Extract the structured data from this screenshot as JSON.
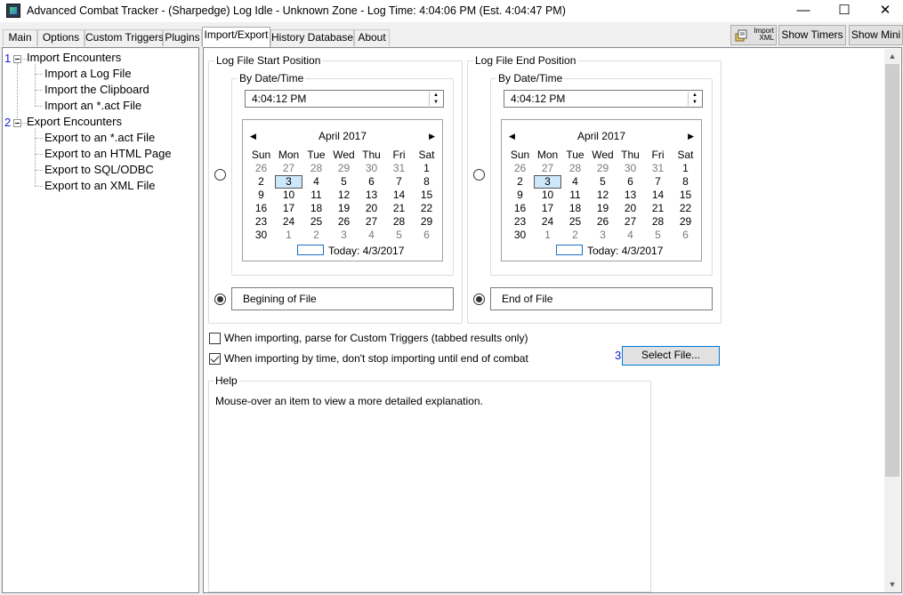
{
  "window": {
    "title": "Advanced Combat Tracker - (Sharpedge) Log Idle - Unknown Zone - Log Time: 4:04:06 PM (Est. 4:04:47 PM)",
    "minimize": "—",
    "maximize": "☐",
    "close": "✕"
  },
  "tabs": [
    {
      "label": "Main"
    },
    {
      "label": "Options"
    },
    {
      "label": "Custom Triggers"
    },
    {
      "label": "Plugins"
    },
    {
      "label": "Import/Export",
      "active": true
    },
    {
      "label": "History Database"
    },
    {
      "label": "About"
    }
  ],
  "toolbar": {
    "import_xml_label_1": "Import",
    "import_xml_label_2": "XML",
    "show_timers": "Show Timers",
    "show_mini": "Show Mini"
  },
  "tree": {
    "groups": [
      {
        "number": "1",
        "label": "Import Encounters",
        "items": [
          "Import a Log File",
          "Import the Clipboard",
          "Import an *.act File"
        ]
      },
      {
        "number": "2",
        "label": "Export Encounters",
        "items": [
          "Export to an *.act File",
          "Export to an HTML Page",
          "Export to SQL/ODBC",
          "Export to an XML File"
        ]
      }
    ]
  },
  "start": {
    "group_title": "Log File Start Position",
    "bydate_title": "By Date/Time",
    "time_value": "4:04:12 PM",
    "calendar_title": "April 2017",
    "position_label": "Begining of File",
    "radio_bydate_checked": false,
    "radio_file_checked": true
  },
  "end": {
    "group_title": "Log File End Position",
    "bydate_title": "By Date/Time",
    "time_value": "4:04:12 PM",
    "calendar_title": "April 2017",
    "position_label": "End of File",
    "radio_bydate_checked": false,
    "radio_file_checked": true
  },
  "calendar": {
    "weekdays": [
      "Sun",
      "Mon",
      "Tue",
      "Wed",
      "Thu",
      "Fri",
      "Sat"
    ],
    "weeks": [
      [
        "26",
        "27",
        "28",
        "29",
        "30",
        "31",
        "1"
      ],
      [
        "2",
        "3",
        "4",
        "5",
        "6",
        "7",
        "8"
      ],
      [
        "9",
        "10",
        "11",
        "12",
        "13",
        "14",
        "15"
      ],
      [
        "16",
        "17",
        "18",
        "19",
        "20",
        "21",
        "22"
      ],
      [
        "23",
        "24",
        "25",
        "26",
        "27",
        "28",
        "29"
      ],
      [
        "30",
        "1",
        "2",
        "3",
        "4",
        "5",
        "6"
      ]
    ],
    "other_month": [
      [
        0,
        0
      ],
      [
        0,
        1
      ],
      [
        0,
        2
      ],
      [
        0,
        3
      ],
      [
        0,
        4
      ],
      [
        0,
        5
      ],
      [
        5,
        1
      ],
      [
        5,
        2
      ],
      [
        5,
        3
      ],
      [
        5,
        4
      ],
      [
        5,
        5
      ],
      [
        5,
        6
      ]
    ],
    "selected": [
      1,
      1
    ],
    "today_label": "Today: 4/3/2017"
  },
  "options": {
    "parse_triggers_label": "When importing, parse for Custom Triggers (tabbed results only)",
    "parse_triggers_checked": false,
    "until_end_label": "When importing by time, don't stop importing until end of combat",
    "until_end_checked": true
  },
  "select_file": {
    "number": "3",
    "label": "Select File..."
  },
  "help": {
    "title": "Help",
    "text": "Mouse-over an item to view a more detailed explanation."
  },
  "colors": {
    "selection_fill": "#cde8fb",
    "focus_border": "#0078d7",
    "marker_number": "#1a1ad2"
  }
}
